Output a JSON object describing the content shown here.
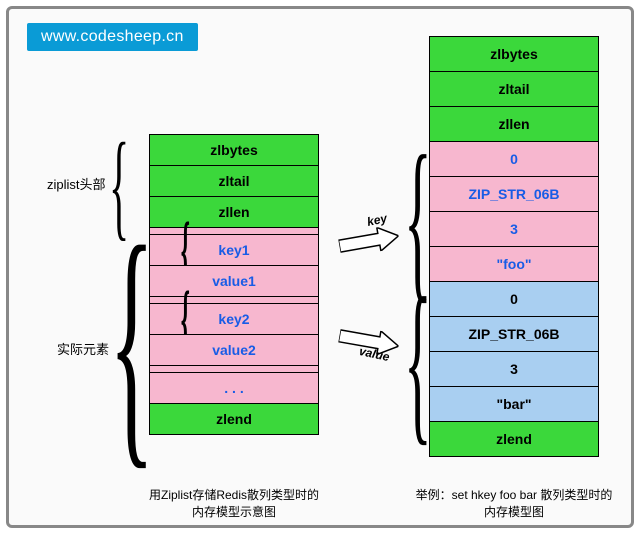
{
  "badge": "www.codesheep.cn",
  "left": {
    "sideLabels": {
      "header": "ziplist头部",
      "elements": "实际元素"
    },
    "cells": {
      "zlbytes": "zlbytes",
      "zltail": "zltail",
      "zllen": "zllen",
      "key1": "key1",
      "value1": "value1",
      "key2": "key2",
      "value2": "value2",
      "ellipsis": ". . .",
      "zlend": "zlend"
    },
    "caption_l1": "用Ziplist存储Redis散列类型时的",
    "caption_l2": "内存模型示意图"
  },
  "right": {
    "cells": {
      "zlbytes": "zlbytes",
      "zltail": "zltail",
      "zllen": "zllen",
      "k_prev": "0",
      "k_enc": "ZIP_STR_06B",
      "k_len": "3",
      "k_val": "\"foo\"",
      "v_prev": "0",
      "v_enc": "ZIP_STR_06B",
      "v_len": "3",
      "v_val": "\"bar\"",
      "zlend": "zlend"
    },
    "caption_l1": "举例：set hkey foo bar 散列类型时的",
    "caption_l2": "内存模型图"
  },
  "arrows": {
    "key": "key",
    "value": "value"
  }
}
